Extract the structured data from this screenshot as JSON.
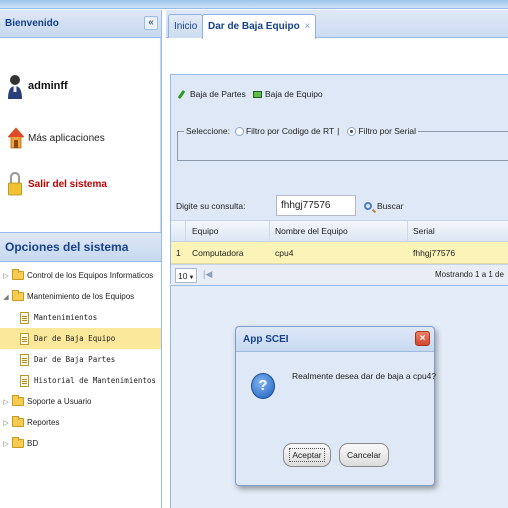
{
  "west": {
    "title": "Bienvenido",
    "collapse_glyph": "«",
    "user": {
      "username": "adminff",
      "more_apps": "Más aplicaciones",
      "logout": "Salir del sistema"
    },
    "options_title": "Opciones del sistema",
    "tree": [
      {
        "label": "Control de los Equipos Informaticos",
        "type": "folder",
        "expanded": false
      },
      {
        "label": "Mantenimiento de los Equipos",
        "type": "folder",
        "expanded": true
      },
      {
        "label": "Mantenimientos",
        "type": "leaf"
      },
      {
        "label": "Dar de Baja Equipo",
        "type": "leaf",
        "selected": true
      },
      {
        "label": "Dar de Baja Partes",
        "type": "leaf"
      },
      {
        "label": "Historial de Mantenimientos",
        "type": "leaf"
      },
      {
        "label": "Soporte a Usuario",
        "type": "folder",
        "expanded": false
      },
      {
        "label": "Reportes",
        "type": "folder",
        "expanded": false
      },
      {
        "label": "BD",
        "type": "folder",
        "expanded": false
      }
    ]
  },
  "tabs": {
    "home": "Inicio",
    "active": "Dar de Baja Equipo",
    "close_glyph": "×"
  },
  "toolbar": {
    "baja_partes": "Baja de Partes",
    "baja_equipo": "Baja de Equipo"
  },
  "filter": {
    "legend": "Seleccione:",
    "option_rt": "Filtro por Codigo de RT",
    "option_sep": "|",
    "option_serial": "Filtro por Serial",
    "selected": "serial"
  },
  "query": {
    "label": "Digite su consulta:",
    "value": "fhhgj77576",
    "search_label": "Buscar"
  },
  "grid": {
    "columns": [
      "Equipo",
      "Nombre del Equipo",
      "Serial"
    ],
    "rows": [
      {
        "num": "1",
        "equipo": "Computadora",
        "nombre": "cpu4",
        "serial": "fhhgj77576"
      }
    ]
  },
  "pager": {
    "page_size": "10",
    "first_glyph": "|◀",
    "summary": "Mostrando 1 a 1 de"
  },
  "dialog": {
    "title": "App SCEI",
    "close_glyph": "×",
    "message": "Realmente desea dar de baja a cpu4?",
    "accept": "Aceptar",
    "cancel": "Cancelar"
  },
  "colors": {
    "header_blue": "#15428b",
    "panel_bg": "#dfe8f6",
    "selected_row": "#fbe89b",
    "grid_row_highlight": "#fbf3b8",
    "logout_red": "#c00000"
  }
}
